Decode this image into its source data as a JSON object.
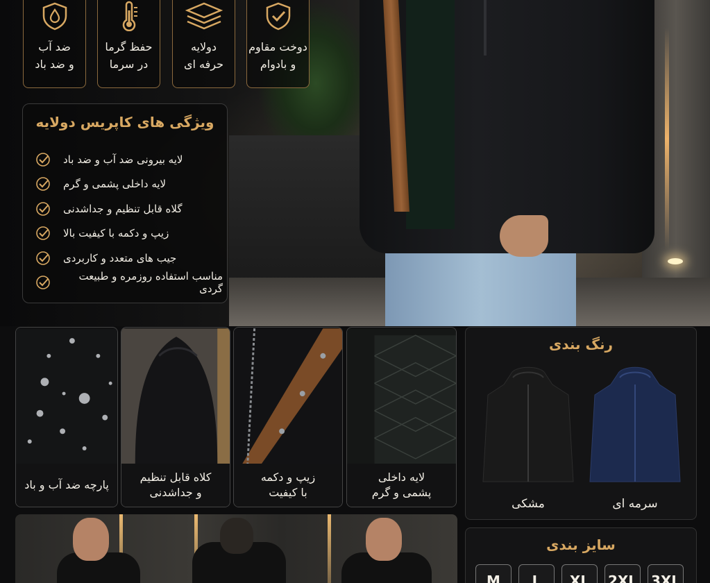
{
  "colors": {
    "accent_gold": "#d8a862",
    "border_gold": "#8c6a3e",
    "navy": "#1c2a4e",
    "black": "#111111"
  },
  "features": [
    {
      "icon": "shield-check-icon",
      "line1": "دوخت مقاوم",
      "line2": "و بادوام"
    },
    {
      "icon": "layers-icon",
      "line1": "دولایه",
      "line2": "حرفه ای"
    },
    {
      "icon": "thermometer-icon",
      "line1": "حفظ گرما",
      "line2": "در سرما"
    },
    {
      "icon": "water-drop-icon",
      "line1": "ضد آب",
      "line2": "و ضد باد"
    }
  ],
  "panel": {
    "title": "ویژگی های کاپریس دولایه",
    "items": [
      "لایه بیرونی ضد آب و ضد باد",
      "لایه داخلی پشمی و گرم",
      "گلاه قابل تنظیم و جداشدنی",
      "زیپ و دکمه با کیفیت بالا",
      "جیب های متعدد و کاربردی",
      "مناسب استفاده روزمره و طبیعت گردی"
    ]
  },
  "tiles": [
    {
      "line1": "پارچه ضد آب و باد",
      "line2": ""
    },
    {
      "line1": "کلاه قابل تنظیم",
      "line2": "و جداشدنی"
    },
    {
      "line1": "زیپ و دکمه",
      "line2": "با کیفیت"
    },
    {
      "line1": "لایه داخلی",
      "line2": "پشمی و گرم"
    }
  ],
  "color_section": {
    "title": "رنگ بندی",
    "options": [
      {
        "label": "مشکی",
        "color": "#1a1a1a"
      },
      {
        "label": "سرمه ای",
        "color": "#1c2a4e"
      }
    ]
  },
  "size_section": {
    "title": "سایز بندی",
    "sizes": [
      "M",
      "L",
      "XL",
      "2XL",
      "3XL"
    ]
  }
}
